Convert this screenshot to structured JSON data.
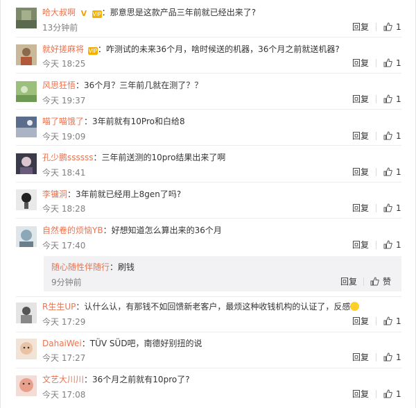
{
  "comments": [
    {
      "user": "哈大叔啊",
      "text": "那意思是这款产品三年前就已经出来了?",
      "time": "13分钟前",
      "reply": "回复",
      "likes": "1",
      "badge": "v"
    },
    {
      "user": "就好搓麻将",
      "text": "咋测试的未来36个月，啥时候送的机器，36个月之前就送机器?",
      "time": "今天 18:25",
      "reply": "回复",
      "likes": "1",
      "badge": "vip"
    },
    {
      "user": "风思狂悟",
      "text": "36个月？三年前几就在测了？？",
      "time": "今天 19:37",
      "reply": "回复",
      "likes": "1"
    },
    {
      "user": "喵了喵饿了",
      "text": "3年前就有10Pro和白给8",
      "time": "今天 19:09",
      "reply": "回复",
      "likes": "1"
    },
    {
      "user": "孔少鹏ssssss",
      "text": "三年前送测的10pro结果出来了啊",
      "time": "今天 18:41",
      "reply": "回复",
      "likes": "1"
    },
    {
      "user": "李镛洞",
      "text": "3年前就已经用上8gen了吗?",
      "time": "今天 18:28",
      "reply": "回复",
      "likes": "1"
    },
    {
      "user": "自然卷的烦恼YB",
      "text": "好想知道怎么算出来的36个月",
      "time": "今天 17:40",
      "reply": "回复",
      "likes": "1"
    },
    {
      "user": "R生生UP",
      "text": "认什么认，有那钱不如回馈新老客户，最烦这种收钱机构的认证了，反感",
      "time": "今天 17:29",
      "reply": "回复",
      "likes": "1"
    },
    {
      "user": "DahaiWei",
      "text": "TÜV SÜD吧，南德好别扭的说",
      "time": "今天 17:27",
      "reply": "回复",
      "likes": "1"
    },
    {
      "user": "文艺大川川",
      "text": "36个月之前就有10pro了?",
      "time": "今天 17:08",
      "reply": "回复",
      "likes": "1"
    }
  ],
  "sub_reply": {
    "user": "随心随性伴随行",
    "text": "刷钱",
    "time": "9分钟前",
    "reply": "回复",
    "likes": "赞"
  }
}
